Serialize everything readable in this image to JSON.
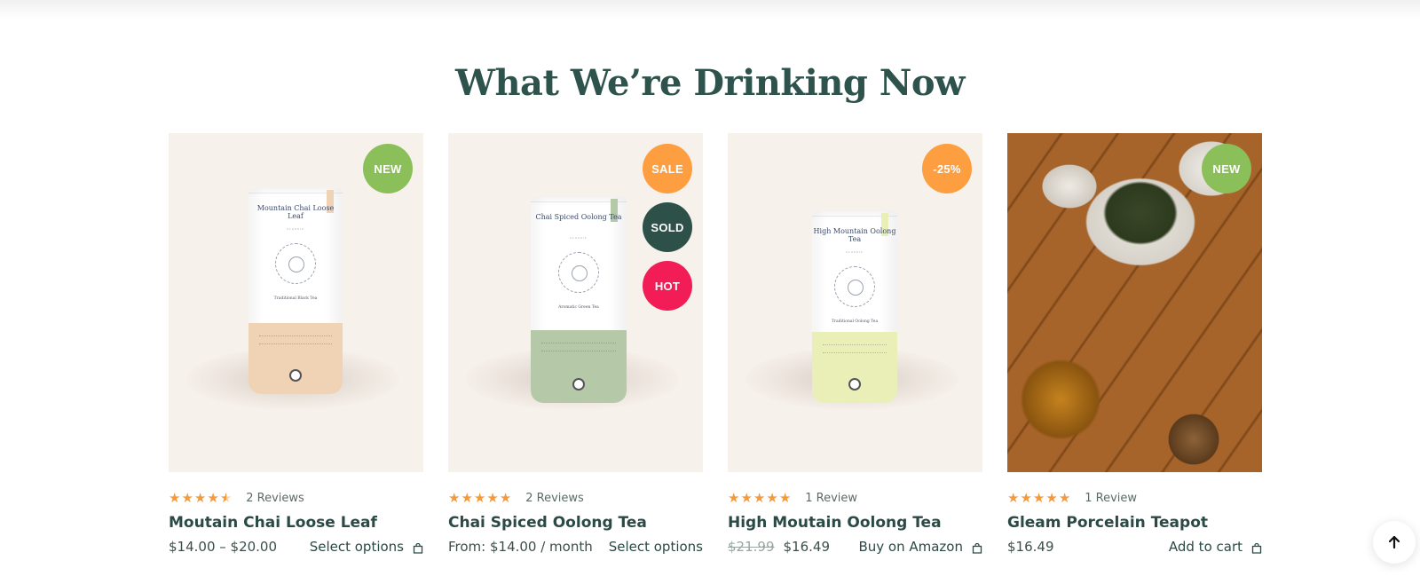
{
  "section": {
    "title": "What We’re Drinking Now"
  },
  "colors": {
    "accent_text": "#2e534d",
    "star": "#f59a3c",
    "badge_new": "#8bbf5a",
    "badge_sale": "#fd9f40",
    "badge_sold": "#2d5148",
    "badge_hot": "#f21c57",
    "badge_discount": "#fd9f40"
  },
  "products": [
    {
      "name": "Moutain Chai Loose Leaf",
      "rating": 4.5,
      "reviews": "2 Reviews",
      "price": "$14.00 – $20.00",
      "old_price": "",
      "action": "Select options",
      "action_icon": "shopping-bag-icon",
      "badges": [
        "NEW"
      ],
      "tin": {
        "label": "Mountain Chai Loose Leaf",
        "sublabel": "CLASSIC",
        "type": "Traditional Black Tea",
        "band_color": "#f0d2b4"
      }
    },
    {
      "name": "Chai Spiced Oolong Tea",
      "rating": 5,
      "reviews": "2 Reviews",
      "price": "From: $14.00 / month",
      "old_price": "",
      "action": "Select options",
      "action_icon": "",
      "badges": [
        "SALE",
        "SOLD",
        "HOT"
      ],
      "tin": {
        "label": "Chai Spiced Oolong Tea",
        "sublabel": "CLASSIC",
        "type": "Aromatic Green Tea",
        "band_color": "#b5c9a8"
      }
    },
    {
      "name": "High Moutain Oolong Tea",
      "rating": 5,
      "reviews": "1 Review",
      "price": "$16.49",
      "old_price": "$21.99",
      "action": "Buy on Amazon",
      "action_icon": "shopping-bag-icon",
      "badges": [
        "-25%"
      ],
      "tin": {
        "label": "High Mountain Oolong Tea",
        "sublabel": "CLASSIC",
        "type": "Traditional Oolong Tea",
        "band_color": "#e9efb6"
      }
    },
    {
      "name": "Gleam Porcelain Teapot",
      "rating": 5,
      "reviews": "1 Review",
      "price": "$16.49",
      "old_price": "",
      "action": "Add to cart",
      "action_icon": "shopping-bag-icon",
      "badges": [
        "NEW"
      ],
      "photo": true
    }
  ],
  "scroll_top": {
    "icon": "arrow-up-icon"
  }
}
